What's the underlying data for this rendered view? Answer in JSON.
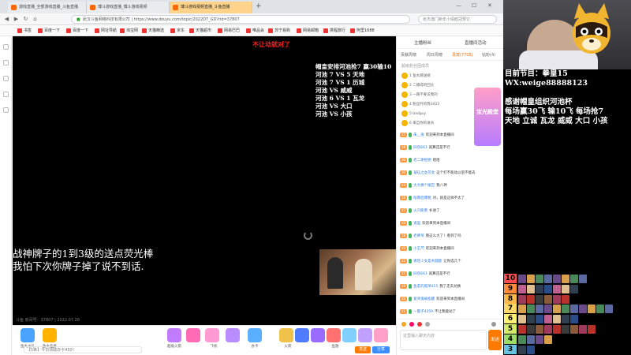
{
  "tabs": [
    {
      "label": "游戏直播_全部游戏直播_斗鱼直播"
    },
    {
      "label": "博斗游戏直播_博斗游戏视频"
    },
    {
      "label": "博斗游戏视频直播_斗鱼直播",
      "active": true
    },
    {
      "label": "+"
    }
  ],
  "window_controls": [
    "—",
    "☐",
    "✕"
  ],
  "address": {
    "site_label": "武汉斗鱼网络科技有限公司",
    "url": "https://www.douyu.com/topic/2022DT_GD?rid=37807",
    "search_placeholder": "张杰澳门新年小倩欧冠预订"
  },
  "bookmarks": [
    "书签",
    "百度一下",
    "百度一下",
    "网址导航",
    "淘宝网",
    "天猫精选",
    "京东",
    "天猫超市",
    "网易巴巴",
    "唯品会",
    "苏宁易购",
    "网易邮箱",
    "携程旅行",
    "阿里1688"
  ],
  "video": {
    "top_tip": "不让动就对了",
    "overlay_lines": [
      "帽皇安排河池抢7 赢30输10",
      "河池 7 VS 5 天地",
      "河池 7 VS 1 历城",
      "河池 VS 威威",
      "河池 6 VS 1 瓦龙",
      "河池 VS 大口",
      "河池 VS 小孩"
    ],
    "subtitle_lines": [
      "战神牌子的1到3级的送点荧光棒",
      "我怕下次你牌子掉了说不到话."
    ],
    "watermark": "斗鱼 房间号：37807 | 2022.07.28"
  },
  "gift_bar": {
    "gifts": [
      "鱼丸大礼",
      "鱼丸任务",
      "超级火箭",
      "飞机",
      "办卡",
      "火箭",
      "鱼翅"
    ],
    "chat_placeholder": "【5条】今日领取办卡450！",
    "send": "发送",
    "share": "分享"
  },
  "chat": {
    "top_tabs": [
      "主播粉丝",
      "直播间活动"
    ],
    "sub_tabs": [
      "贡献周榜",
      "周日周榜",
      "贵宾(7705)",
      "钻粉(4)"
    ],
    "rank_header": "超级粉丝团成员",
    "rank_rows": [
      "1 鱼丸赠送榜",
      "2 二播得的回头",
      "3 一路不要说我的",
      "4 粉丝时的我3423",
      "5 badguy",
      "6 来自你的进贡"
    ],
    "promo_label": "宝光殿堂",
    "messages": [
      {
        "lv": "25",
        "user": "朱__逸",
        "text": "欢迎来到本直播间"
      },
      {
        "lv": "18",
        "user": "旧伤661",
        "text": "就算还是不行"
      },
      {
        "lv": "30",
        "user": "老二谢祖德",
        "text": "哈哈"
      },
      {
        "lv": "30",
        "user": "凝珏之女莎女",
        "text": "这个打不能动以后不能去"
      },
      {
        "lv": "24",
        "user": "大大换个尾巴",
        "text": "我八神"
      },
      {
        "lv": "16",
        "user": "陪寡后爆粗",
        "text": "对，就是这样不太了"
      },
      {
        "lv": "15",
        "user": "火只能看",
        "text": "补进了"
      },
      {
        "lv": "20",
        "user": "道里",
        "text": "欢迎来到本直播间"
      },
      {
        "lv": "18",
        "user": "老佛爷",
        "text": "我这么大了！看到了吗"
      },
      {
        "lv": "20",
        "user": "小王尺",
        "text": "欢迎来到本直播间"
      },
      {
        "lv": "22",
        "user": "谢旺少女是木圆醇",
        "text": "让你选几个"
      },
      {
        "lv": "17",
        "user": "旧伤661",
        "text": "就算还是不行"
      },
      {
        "lv": "19",
        "user": "鱼友的孤单415",
        "text": "我了走去兑换"
      },
      {
        "lv": "20",
        "user": "爱哭鬼被掐醒",
        "text": "欢迎来到本直播间"
      },
      {
        "lv": "21",
        "user": "一瞥子4259",
        "text": "不让我能动了"
      }
    ],
    "input_placeholder": "这里输入聊天内容",
    "send": "发送"
  },
  "stream_panel": {
    "anchor_lines": [
      "目前节目：拳皇15",
      "WX:weige88888123"
    ],
    "thanks_lines": [
      "感谢帽皇组织河池杯",
      "每场赢30飞 输10飞 每场抢7",
      "天地 立诚 瓦龙 威威 大口 小孩"
    ],
    "tier_numbers": [
      "10",
      "9",
      "8",
      "7",
      "6",
      "5",
      "4",
      "3"
    ],
    "tier_colors": [
      "#ff4d4d",
      "#ff8c3a",
      "#ffb84a",
      "#ffd966",
      "#fff176",
      "#d6ea6a",
      "#9edc68",
      "#66c2e0"
    ]
  }
}
